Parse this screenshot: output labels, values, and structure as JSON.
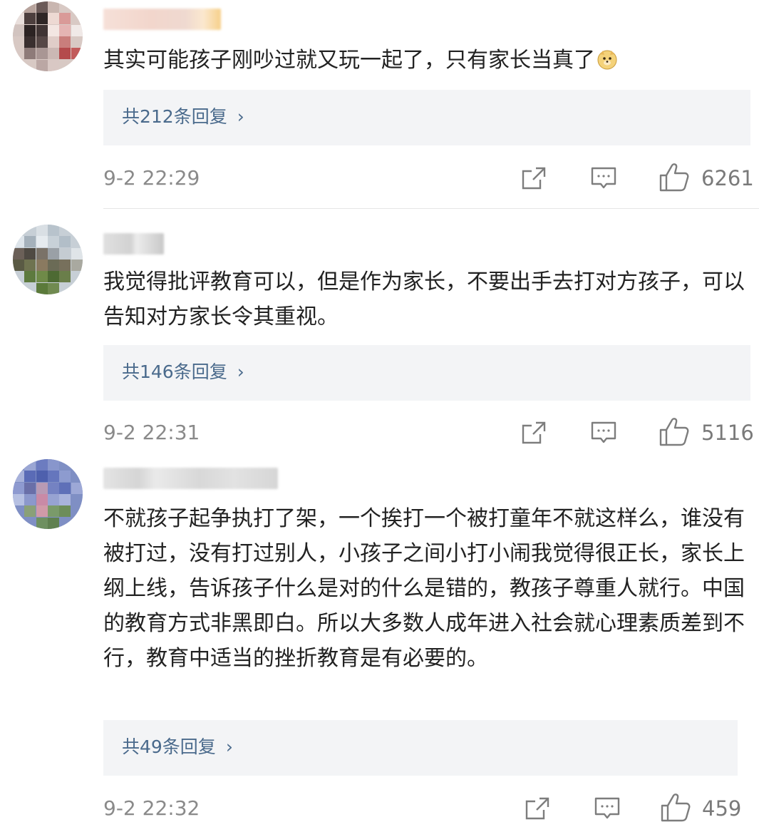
{
  "comments": [
    {
      "text": "其实可能孩子刚吵过就又玩一起了，只有家长当真了",
      "emoji": "doge-emoji",
      "replies_label": "共212条回复",
      "time": "9-2 22:29",
      "likes": "6261"
    },
    {
      "text": "我觉得批评教育可以，但是作为家长，不要出手去打对方孩子，可以告知对方家长令其重视。",
      "replies_label": "共146条回复",
      "time": "9-2 22:31",
      "likes": "5116"
    },
    {
      "text": "不就孩子起争执打了架，一个挨打一个被打童年不就这样么，谁没有被打过，没有打过别人，小孩子之间小打小闹我觉得很正长，家长上纲上线，告诉孩子什么是对的什么是错的，教孩子尊重人就行。中国的教育方式非黑即白。所以大多数人成年进入社会就心理素质差到不行，教育中适当的挫折教育是有必要的。",
      "replies_label": "共49条回复",
      "time": "9-2 22:32",
      "likes": "459"
    }
  ],
  "icons": {
    "share": "share-icon",
    "comment": "comment-icon",
    "like": "thumbs-up-icon",
    "chevron": "chevron-right-icon"
  },
  "colors": {
    "reply_link": "#4a6a8c",
    "reply_bg": "#f3f4f6",
    "meta_text": "#8a8a8a"
  }
}
